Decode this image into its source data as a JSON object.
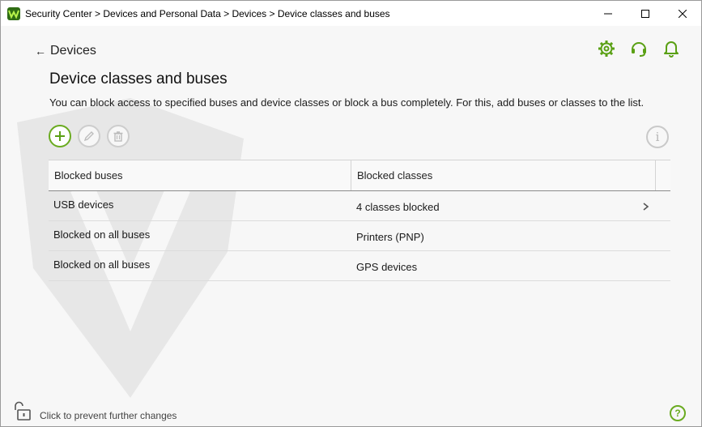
{
  "window": {
    "title": "Security Center > Devices and Personal Data > Devices > Device classes and buses"
  },
  "colors": {
    "accent": "#6aab20",
    "disabled": "#cdcdcd"
  },
  "nav": {
    "back_label": "Devices"
  },
  "header_icons": [
    "gear-icon",
    "headset-icon",
    "bell-icon"
  ],
  "page": {
    "title": "Device classes and buses",
    "description": "You can block access to specified buses and device classes or block a bus completely. For this, add buses or classes to the list."
  },
  "toolbar": [
    "add-icon",
    "edit-icon",
    "delete-icon"
  ],
  "info_glyph": "i",
  "table": {
    "headers": {
      "buses": "Blocked buses",
      "classes": "Blocked classes"
    },
    "rows": [
      {
        "bus": "USB devices",
        "classes": "4 classes blocked",
        "expandable": true
      },
      {
        "bus": "Blocked on all buses",
        "classes": "Printers (PNP)",
        "expandable": false
      },
      {
        "bus": "Blocked on all buses",
        "classes": "GPS devices",
        "expandable": false
      }
    ]
  },
  "footer": {
    "lock_text": "Click to prevent further changes",
    "help_glyph": "?"
  }
}
